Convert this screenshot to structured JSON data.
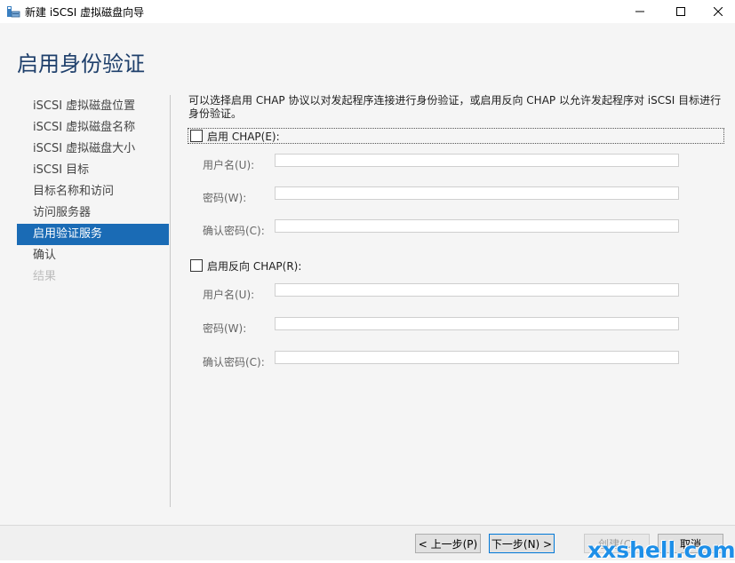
{
  "window": {
    "title": "新建 iSCSI 虚拟磁盘向导",
    "icon": "wizard-disk-icon",
    "controls": [
      "minimize-icon",
      "maximize-icon",
      "close-icon"
    ]
  },
  "page": {
    "title": "启用身份验证"
  },
  "nav": {
    "items": [
      {
        "label": "iSCSI 虚拟磁盘位置",
        "state": "normal"
      },
      {
        "label": "iSCSI 虚拟磁盘名称",
        "state": "normal"
      },
      {
        "label": "iSCSI 虚拟磁盘大小",
        "state": "normal"
      },
      {
        "label": "iSCSI 目标",
        "state": "normal"
      },
      {
        "label": "目标名称和访问",
        "state": "normal"
      },
      {
        "label": "访问服务器",
        "state": "normal"
      },
      {
        "label": "启用验证服务",
        "state": "active"
      },
      {
        "label": "确认",
        "state": "normal"
      },
      {
        "label": "结果",
        "state": "disabled"
      }
    ]
  },
  "main": {
    "description": "可以选择启用 CHAP 协议以对发起程序连接进行身份验证，或启用反向 CHAP 以允许发起程序对 iSCSI 目标进行身份验证。",
    "chap": {
      "label": "启用 CHAP(E):",
      "checked": false,
      "username_label": "用户名(U):",
      "username_value": "",
      "password_label": "密码(W):",
      "password_value": "",
      "confirm_label": "确认密码(C):",
      "confirm_value": ""
    },
    "reverse_chap": {
      "label": "启用反向 CHAP(R):",
      "checked": false,
      "username_label": "用户名(U):",
      "username_value": "",
      "password_label": "密码(W):",
      "password_value": "",
      "confirm_label": "确认密码(C):",
      "confirm_value": ""
    }
  },
  "footer": {
    "prev_label": "< 上一步(P)",
    "next_label": "下一步(N) >",
    "create_label": "创建(C)",
    "cancel_label": "取消"
  },
  "watermark": {
    "text": "xxshell.com",
    "color": "#1d8fe8"
  },
  "colors": {
    "accent": "#1a6bb5",
    "title": "#1e3f6b"
  }
}
